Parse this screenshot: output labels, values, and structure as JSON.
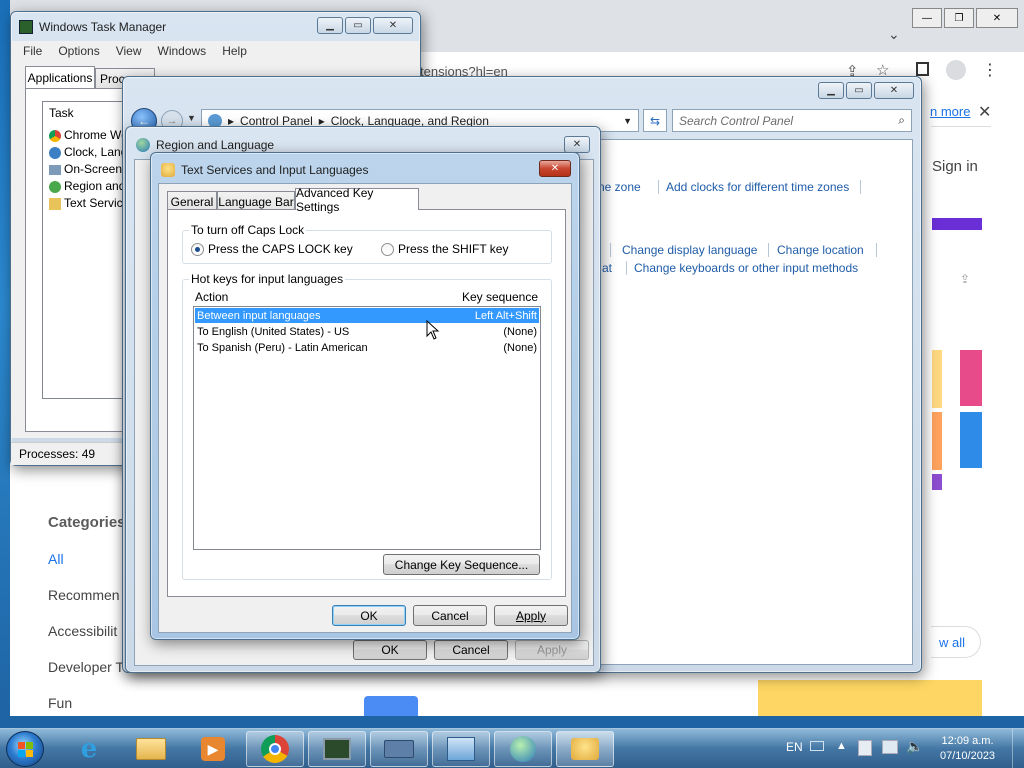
{
  "task_manager": {
    "title": "Windows Task Manager",
    "menu": [
      "File",
      "Options",
      "View",
      "Windows",
      "Help"
    ],
    "tabs": [
      "Applications",
      "Proc"
    ],
    "column_task": "Task",
    "tasks": [
      "Chrome Wel",
      "Clock, Langu",
      "On-Screen K",
      "Region and",
      "Text Service"
    ],
    "status": "Processes: 49"
  },
  "chrome": {
    "url_fragment": "tensions?hl=en",
    "learn_more": "n more",
    "sign_in": "Sign in",
    "categories_title": "Categories",
    "categories": [
      "All",
      "Recommen",
      "Accessibilit",
      "Developer T",
      "Fun"
    ],
    "view_all": "w all"
  },
  "control_panel": {
    "breadcrumb": [
      "Control Panel",
      "Clock, Language, and Region"
    ],
    "search_placeholder": "Search Control Panel",
    "links": {
      "time_zone": "ne zone",
      "add_clocks": "Add clocks for different time zones",
      "change_display_language": "Change display language",
      "change_location": "Change location",
      "at_fragment": "at",
      "change_keyboards": "Change keyboards or other input methods"
    }
  },
  "region_dialog": {
    "title": "Region and Language",
    "ok": "OK",
    "cancel": "Cancel",
    "apply": "Apply"
  },
  "tsil_dialog": {
    "title": "Text Services and Input Languages",
    "tabs": [
      "General",
      "Language Bar",
      "Advanced Key Settings"
    ],
    "caps_group": "To turn off Caps Lock",
    "radio_caps": "Press the CAPS LOCK key",
    "radio_shift": "Press the SHIFT key",
    "hotkeys_group": "Hot keys for input languages",
    "col_action": "Action",
    "col_keyseq": "Key sequence",
    "rows": [
      {
        "action": "Between input languages",
        "key": "Left Alt+Shift",
        "selected": true
      },
      {
        "action": "To English (United States) - US",
        "key": "(None)",
        "selected": false
      },
      {
        "action": "To Spanish (Peru) - Latin American",
        "key": "(None)",
        "selected": false
      }
    ],
    "change_key_sequence": "Change Key Sequence...",
    "ok": "OK",
    "cancel": "Cancel",
    "apply": "Apply"
  },
  "taskbar": {
    "language": "EN",
    "time": "12:09 a.m.",
    "date": "07/10/2023"
  },
  "colors": {
    "selection": "#3399ff",
    "link": "#1f5ca8",
    "desktop": "#2c8ad0"
  }
}
